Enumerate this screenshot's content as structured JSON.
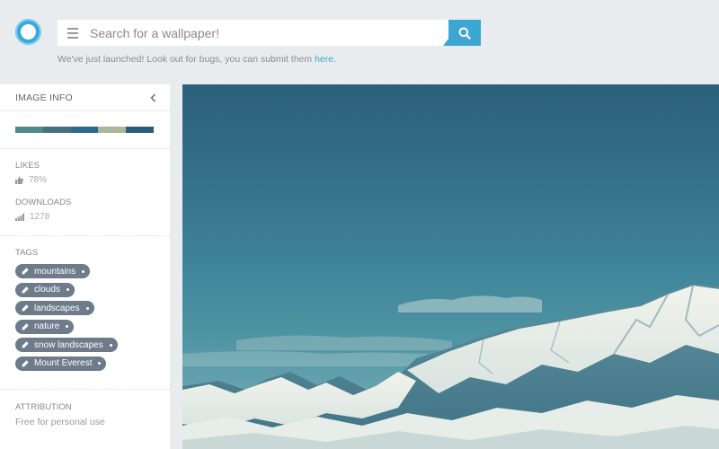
{
  "search": {
    "placeholder": "Search for a wallpaper!"
  },
  "notice": {
    "text": "We've just launched! Look out for bugs, you can submit them ",
    "link": "here",
    "suffix": "."
  },
  "sidebar": {
    "title": "IMAGE INFO",
    "palette": [
      "#4e8a8e",
      "#46707d",
      "#2b6a8a",
      "#a9b89a",
      "#2d5c79"
    ],
    "likes": {
      "label": "LIKES",
      "value": "78%"
    },
    "downloads": {
      "label": "DOWNLOADS",
      "value": "1278"
    },
    "tags": {
      "label": "TAGS",
      "items": [
        "mountains",
        "clouds",
        "landscapes",
        "nature",
        "snow landscapes",
        "Mount Everest"
      ]
    },
    "attribution": {
      "label": "ATTRIBUTION",
      "text": "Free for personal use"
    }
  },
  "icons": {
    "logo": "app-logo",
    "menu": "menu-icon",
    "search": "search-icon",
    "chevron": "chevron-left-icon",
    "likes": "thumbs-up-icon",
    "downloads": "bar-chart-icon",
    "tag": "tag-icon"
  },
  "colors": {
    "accent": "#3ea6d3",
    "tag_bg": "#6e7b8b"
  }
}
